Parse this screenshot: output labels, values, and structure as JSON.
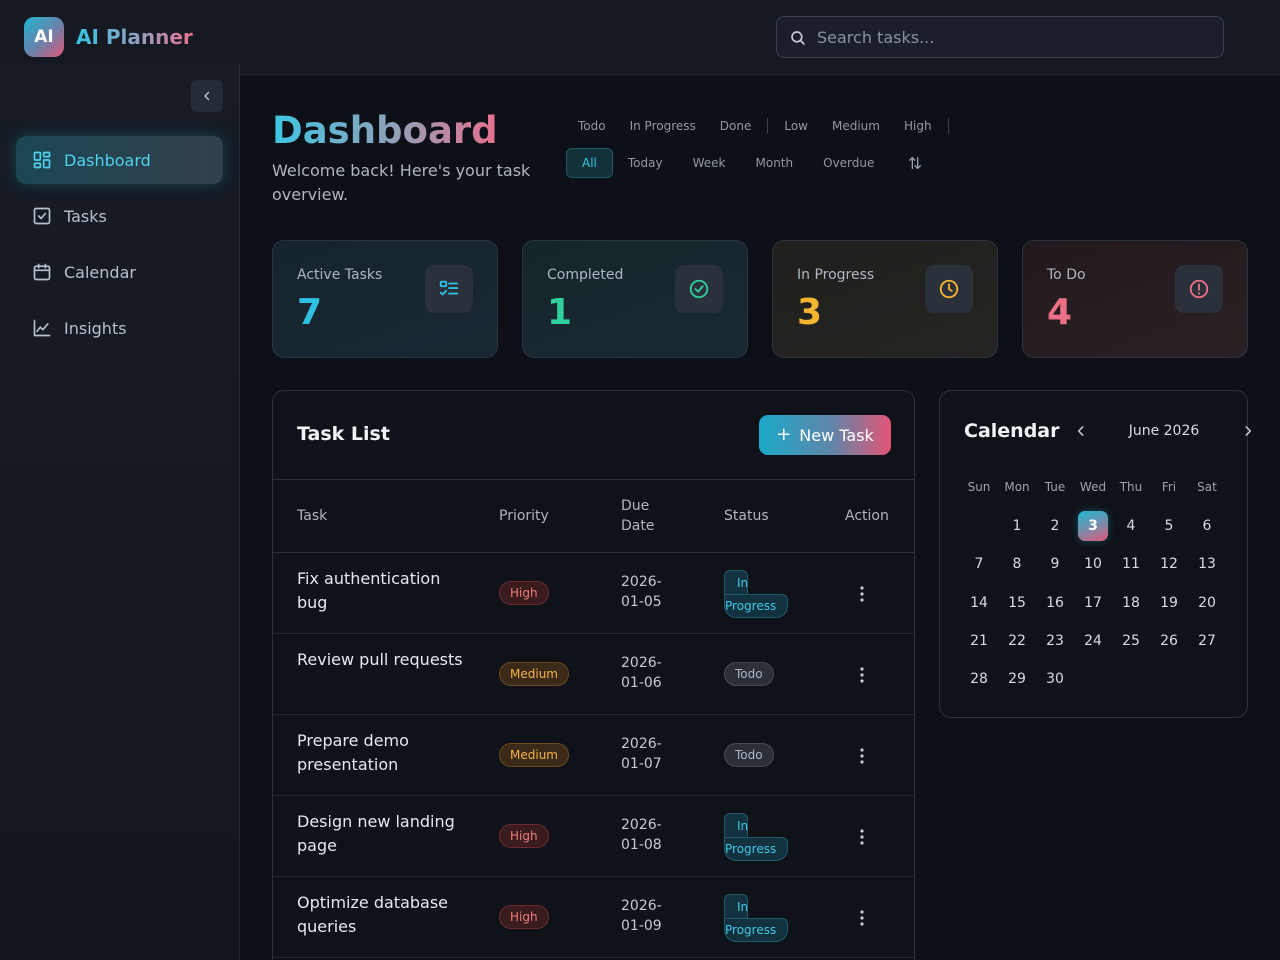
{
  "app": {
    "logo_text": "AI",
    "title": "AI Planner"
  },
  "search": {
    "placeholder": "Search tasks..."
  },
  "sidebar": {
    "items": [
      {
        "label": "Dashboard",
        "icon": "dashboard-icon",
        "active": true
      },
      {
        "label": "Tasks",
        "icon": "checkbox-icon"
      },
      {
        "label": "Calendar",
        "icon": "calendar-icon"
      },
      {
        "label": "Insights",
        "icon": "chart-line-icon"
      }
    ]
  },
  "page": {
    "title": "Dashboard",
    "subtitle": "Welcome back! Here's your task overview."
  },
  "filters": {
    "status": [
      "Todo",
      "In Progress",
      "Done"
    ],
    "priority": [
      "Low",
      "Medium",
      "High"
    ],
    "range": [
      "All",
      "Today",
      "Week",
      "Month",
      "Overdue"
    ],
    "range_active": "All"
  },
  "stats": [
    {
      "label": "Active Tasks",
      "value": "7",
      "color": "#2ec0e2",
      "icon": "list-check-icon"
    },
    {
      "label": "Completed",
      "value": "1",
      "color": "#2fcf9c",
      "icon": "check-circle-icon"
    },
    {
      "label": "In Progress",
      "value": "3",
      "color": "#f5b52e",
      "icon": "clock-icon"
    },
    {
      "label": "To Do",
      "value": "4",
      "color": "#ec6f86",
      "icon": "alert-circle-icon"
    }
  ],
  "task_list": {
    "title": "Task List",
    "new_task_label": "New Task",
    "headers": {
      "task": "Task",
      "priority": "Priority",
      "due": "Due Date",
      "status": "Status",
      "action": "Action"
    },
    "rows": [
      {
        "task": "Fix authentication bug",
        "priority": "High",
        "due": "2026-01-05",
        "status": "In Progress"
      },
      {
        "task": "Review pull requests",
        "priority": "Medium",
        "due": "2026-01-06",
        "status": "Todo"
      },
      {
        "task": "Prepare demo presentation",
        "priority": "Medium",
        "due": "2026-01-07",
        "status": "Todo"
      },
      {
        "task": "Design new landing page",
        "priority": "High",
        "due": "2026-01-08",
        "status": "In Progress"
      },
      {
        "task": "Optimize database queries",
        "priority": "High",
        "due": "2026-01-09",
        "status": "In Progress"
      }
    ]
  },
  "calendar": {
    "title": "Calendar",
    "month_label": "June 2026",
    "weekdays": [
      "Sun",
      "Mon",
      "Tue",
      "Wed",
      "Thu",
      "Fri",
      "Sat"
    ],
    "days": [
      "1",
      "2",
      "3",
      "4",
      "5",
      "6",
      "7",
      "8",
      "9",
      "10",
      "11",
      "12",
      "13",
      "14",
      "15",
      "16",
      "17",
      "18",
      "19",
      "20",
      "21",
      "22",
      "23",
      "24",
      "25",
      "26",
      "27",
      "28",
      "29",
      "30"
    ],
    "today": "3"
  }
}
